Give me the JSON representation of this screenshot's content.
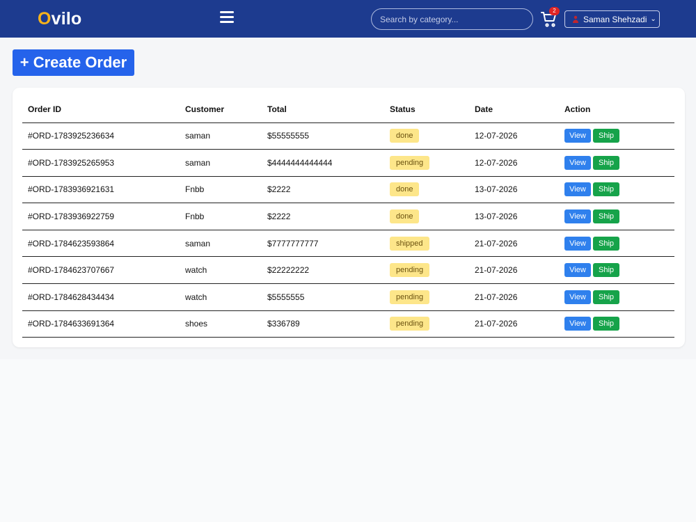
{
  "header": {
    "logo_first": "O",
    "logo_rest": "vilo",
    "search_placeholder": "Search by category...",
    "cart_count": "2",
    "user_name": "Saman Shehzadi"
  },
  "actions": {
    "create_order": "+ Create Order"
  },
  "table": {
    "headers": [
      "Order ID",
      "Customer",
      "Total",
      "Status",
      "Date",
      "Action"
    ],
    "view_label": "View",
    "ship_label": "Ship",
    "rows": [
      {
        "id": "#ORD-1783925236634",
        "customer": "saman",
        "total": "$55555555",
        "status": "done",
        "date": "12-07-2026"
      },
      {
        "id": "#ORD-1783925265953",
        "customer": "saman",
        "total": "$4444444444444",
        "status": "pending",
        "date": "12-07-2026"
      },
      {
        "id": "#ORD-1783936921631",
        "customer": "Fnbb",
        "total": "$2222",
        "status": "done",
        "date": "13-07-2026"
      },
      {
        "id": "#ORD-1783936922759",
        "customer": "Fnbb",
        "total": "$2222",
        "status": "done",
        "date": "13-07-2026"
      },
      {
        "id": "#ORD-1784623593864",
        "customer": "saman",
        "total": "$7777777777",
        "status": "shipped",
        "date": "21-07-2026"
      },
      {
        "id": "#ORD-1784623707667",
        "customer": "watch",
        "total": "$22222222",
        "status": "pending",
        "date": "21-07-2026"
      },
      {
        "id": "#ORD-1784628434434",
        "customer": "watch",
        "total": "$5555555",
        "status": "pending",
        "date": "21-07-2026"
      },
      {
        "id": "#ORD-1784633691364",
        "customer": "shoes",
        "total": "$336789",
        "status": "pending",
        "date": "21-07-2026"
      }
    ]
  },
  "colors": {
    "navbar": "#1d3b8f",
    "logo_accent": "#f6b21b",
    "primary_button": "#2563eb",
    "view_button": "#2f80ed",
    "ship_button": "#16a34a",
    "status_badge": "#fde68a",
    "cart_badge": "#e02424"
  },
  "icons": {
    "menu": "hamburger-menu-icon",
    "cart": "shopping-cart-icon",
    "user": "user-icon",
    "dropdown": "chevron-down-icon"
  }
}
